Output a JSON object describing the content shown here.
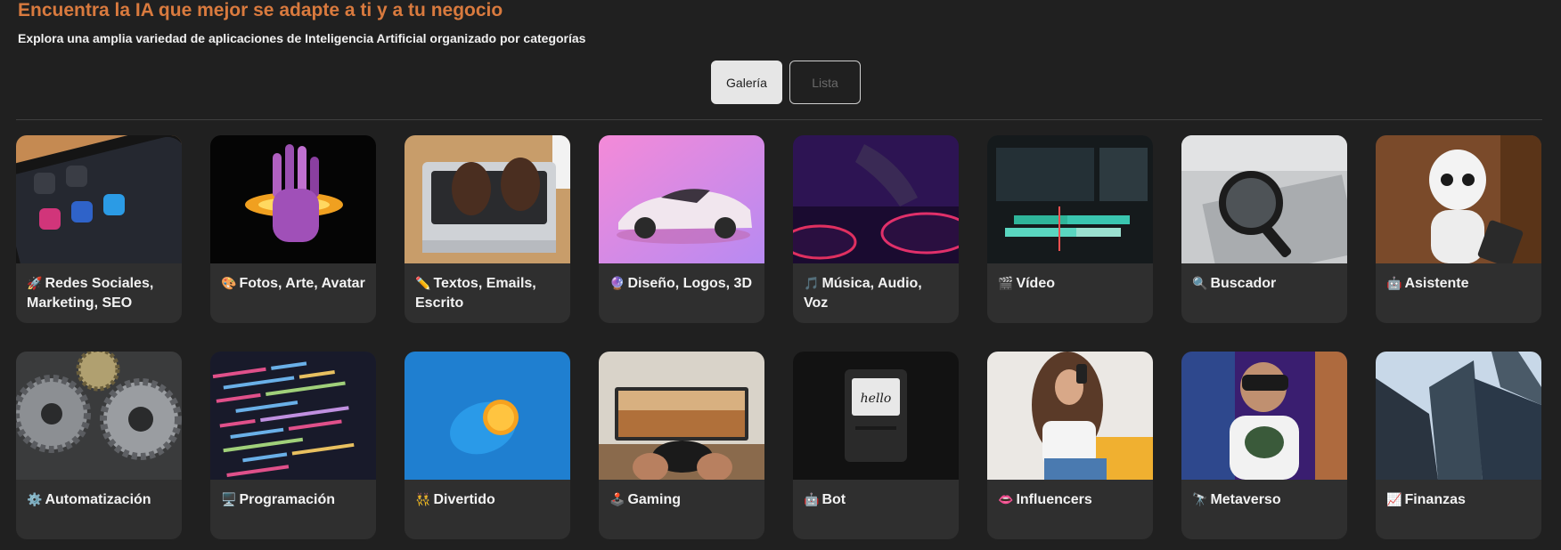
{
  "header": {
    "title": "Encuentra la IA que mejor se adapte a ti y a tu negocio",
    "subtitle": "Explora una amplia variedad de aplicaciones de Inteligencia Artificial organizado por categorías"
  },
  "view_toggle": {
    "gallery_label": "Galería",
    "list_label": "Lista",
    "active": "Galería"
  },
  "categories": [
    {
      "emoji": "🚀",
      "label": "Redes Sociales, Marketing, SEO",
      "image": "social-media-phone"
    },
    {
      "emoji": "🎨",
      "label": "Fotos, Arte, Avatar",
      "image": "glowing-hand"
    },
    {
      "emoji": "✏️",
      "label": "Textos, Emails, Escrito",
      "image": "typing-laptop"
    },
    {
      "emoji": "🔮",
      "label": "Diseño, Logos, 3D",
      "image": "sports-car"
    },
    {
      "emoji": "🎵",
      "label": "Música, Audio, Voz",
      "image": "dj-turntable"
    },
    {
      "emoji": "🎬",
      "label": "Vídeo",
      "image": "video-editor"
    },
    {
      "emoji": "🔍",
      "label": "Buscador",
      "image": "magnifier-laptop"
    },
    {
      "emoji": "🤖",
      "label": "Asistente",
      "image": "robot"
    },
    {
      "emoji": "⚙️",
      "label": "Automatización",
      "image": "gears"
    },
    {
      "emoji": "🖥️",
      "label": "Programación",
      "image": "code-screen"
    },
    {
      "emoji": "👯",
      "label": "Divertido",
      "image": "lemon"
    },
    {
      "emoji": "🕹️",
      "label": "Gaming",
      "image": "game-controller"
    },
    {
      "emoji": "🤖",
      "label": "Bot",
      "image": "hello-computer"
    },
    {
      "emoji": "👄",
      "label": "Influencers",
      "image": "influencer-selfie"
    },
    {
      "emoji": "🔭",
      "label": "Metaverso",
      "image": "vr-headset"
    },
    {
      "emoji": "📈",
      "label": "Finanzas",
      "image": "skyscrapers"
    }
  ]
}
